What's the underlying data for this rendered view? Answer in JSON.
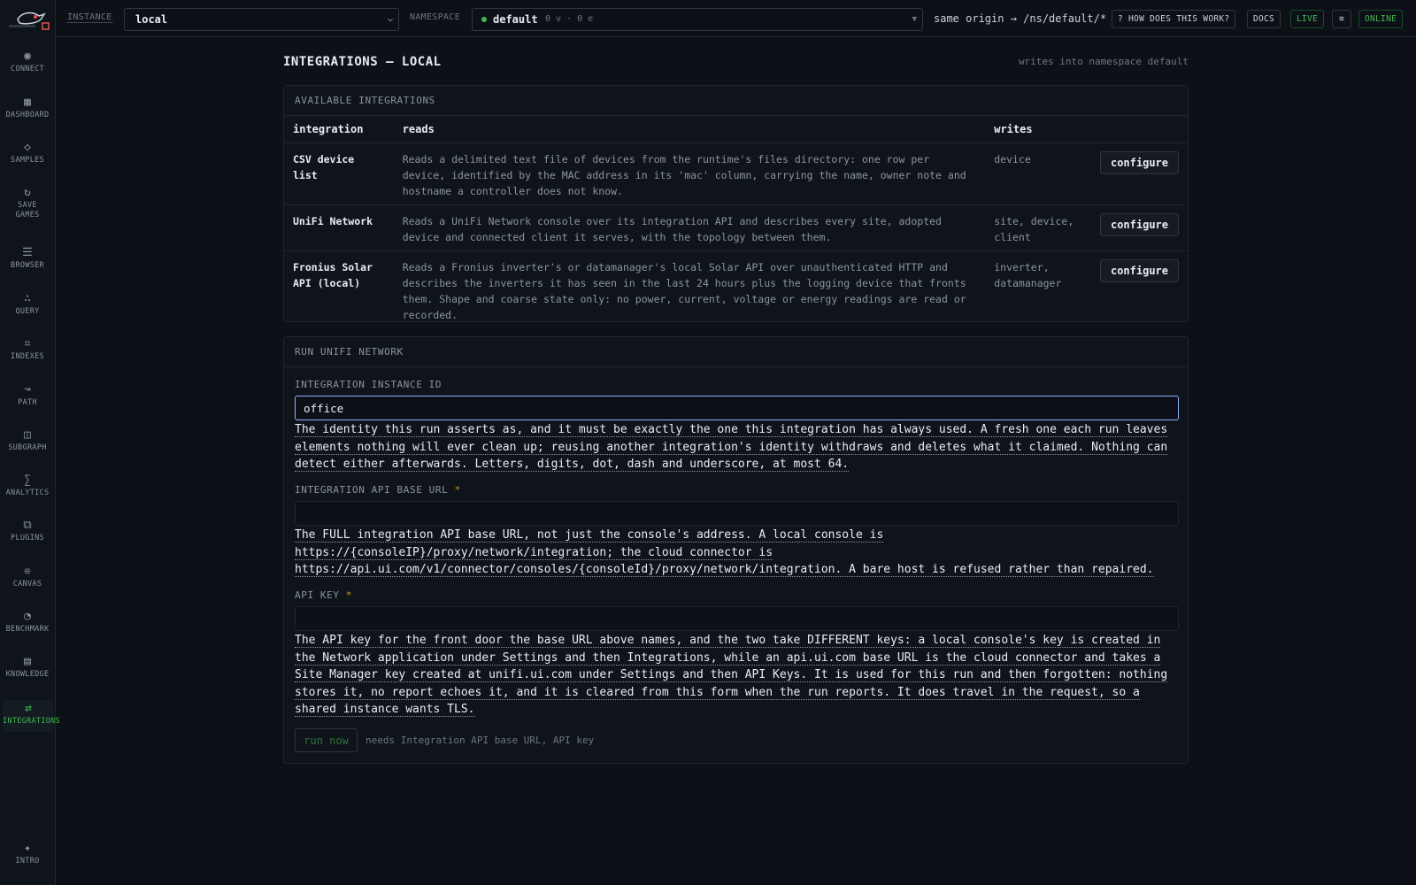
{
  "sidebar": {
    "items": [
      {
        "label": "CONNECT",
        "icon": "◉",
        "icon_name": "connect-icon"
      },
      {
        "label": "DASHBOARD",
        "icon": "▦",
        "icon_name": "dashboard-icon"
      },
      {
        "label": "SAMPLES",
        "icon": "◇",
        "icon_name": "samples-icon"
      },
      {
        "label": "SAVE GAMES",
        "icon": "↻",
        "icon_name": "save-games-icon"
      },
      {
        "label": "BROWSER",
        "icon": "☰",
        "icon_name": "browser-icon"
      },
      {
        "label": "QUERY",
        "icon": "∴",
        "icon_name": "query-icon"
      },
      {
        "label": "INDEXES",
        "icon": "⌗",
        "icon_name": "indexes-icon"
      },
      {
        "label": "PATH",
        "icon": "↝",
        "icon_name": "path-icon"
      },
      {
        "label": "SUBGRAPH",
        "icon": "◫",
        "icon_name": "subgraph-icon"
      },
      {
        "label": "ANALYTICS",
        "icon": "∑",
        "icon_name": "analytics-icon"
      },
      {
        "label": "PLUGINS",
        "icon": "⧉",
        "icon_name": "plugins-icon"
      },
      {
        "label": "CANVAS",
        "icon": "❊",
        "icon_name": "canvas-icon"
      },
      {
        "label": "BENCHMARK",
        "icon": "◔",
        "icon_name": "benchmark-icon"
      },
      {
        "label": "KNOWLEDGE",
        "icon": "▤",
        "icon_name": "knowledge-icon"
      },
      {
        "label": "INTEGRATIONS",
        "icon": "⇄",
        "icon_name": "integrations-icon",
        "active": true
      }
    ],
    "intro": {
      "label": "INTRO",
      "icon": "✦"
    }
  },
  "topbar": {
    "instance_label": "INSTANCE",
    "instance_value": "local",
    "namespace_label": "NAMESPACE",
    "namespace_value": "default",
    "namespace_counts": "0 v · 0 e",
    "route": "same origin → /ns/default/*",
    "how_button": "? HOW DOES THIS WORK?",
    "docs_button": "DOCS",
    "live_button": "LIVE",
    "theme_icon": "≋",
    "status": "ONLINE"
  },
  "page": {
    "title": "INTEGRATIONS — LOCAL",
    "note": "writes into namespace default"
  },
  "available": {
    "heading": "AVAILABLE INTEGRATIONS",
    "columns": [
      "integration",
      "reads",
      "writes"
    ],
    "rows": [
      {
        "name": "CSV device list",
        "reads": "Reads a delimited text file of devices from the runtime's files directory: one row per device, identified by the MAC address in its 'mac' column, carrying the name, owner note and hostname a controller does not know.",
        "writes": "device",
        "action": "configure"
      },
      {
        "name": "UniFi Network",
        "reads": "Reads a UniFi Network console over its integration API and describes every site, adopted device and connected client it serves, with the topology between them.",
        "writes": "site, device, client",
        "action": "configure"
      },
      {
        "name": "Fronius Solar API (local)",
        "reads": "Reads a Fronius inverter's or datamanager's local Solar API over unauthenticated HTTP and describes the inverters it has seen in the last 24 hours plus the logging device that fronts them. Shape and coarse state only: no power, current, voltage or energy readings are read or recorded.",
        "writes": "inverter, datamanager",
        "action": "configure"
      }
    ]
  },
  "run": {
    "heading": "RUN UNIFI NETWORK",
    "instance_id_label": "INTEGRATION INSTANCE ID",
    "instance_id_value": "office",
    "instance_id_help": "The identity this run asserts as, and it must be exactly the one this integration has always used. A fresh one each run leaves elements nothing will ever clean up; reusing another integration's identity withdraws and deletes what it claimed. Nothing can detect either afterwards. Letters, digits, dot, dash and underscore, at most 64.",
    "base_url_label": "INTEGRATION API BASE URL",
    "base_url_value": "",
    "base_url_help": "The FULL integration API base URL, not just the console's address. A local console is https://{consoleIP}/proxy/network/integration; the cloud connector is https://api.ui.com/v1/connector/consoles/{consoleId}/proxy/network/integration. A bare host is refused rather than repaired.",
    "api_key_label": "API KEY",
    "api_key_value": "",
    "api_key_help": "The API key for the front door the base URL above names, and the two take DIFFERENT keys: a local console's key is created in the Network application under Settings and then Integrations, while an api.ui.com base URL is the cloud connector and takes a Site Manager key created at unifi.ui.com under Settings and then API Keys. It is used for this run and then forgotten: nothing stores it, no report echoes it, and it is cleared from this form when the run reports. It does travel in the request, so a shared instance wants TLS.",
    "required_mark": "*",
    "run_button": "run now",
    "run_note": "needs Integration API base URL, API key"
  },
  "colors": {
    "accent_green": "#3fb950",
    "background": "#0d1117",
    "required": "#d29922"
  }
}
